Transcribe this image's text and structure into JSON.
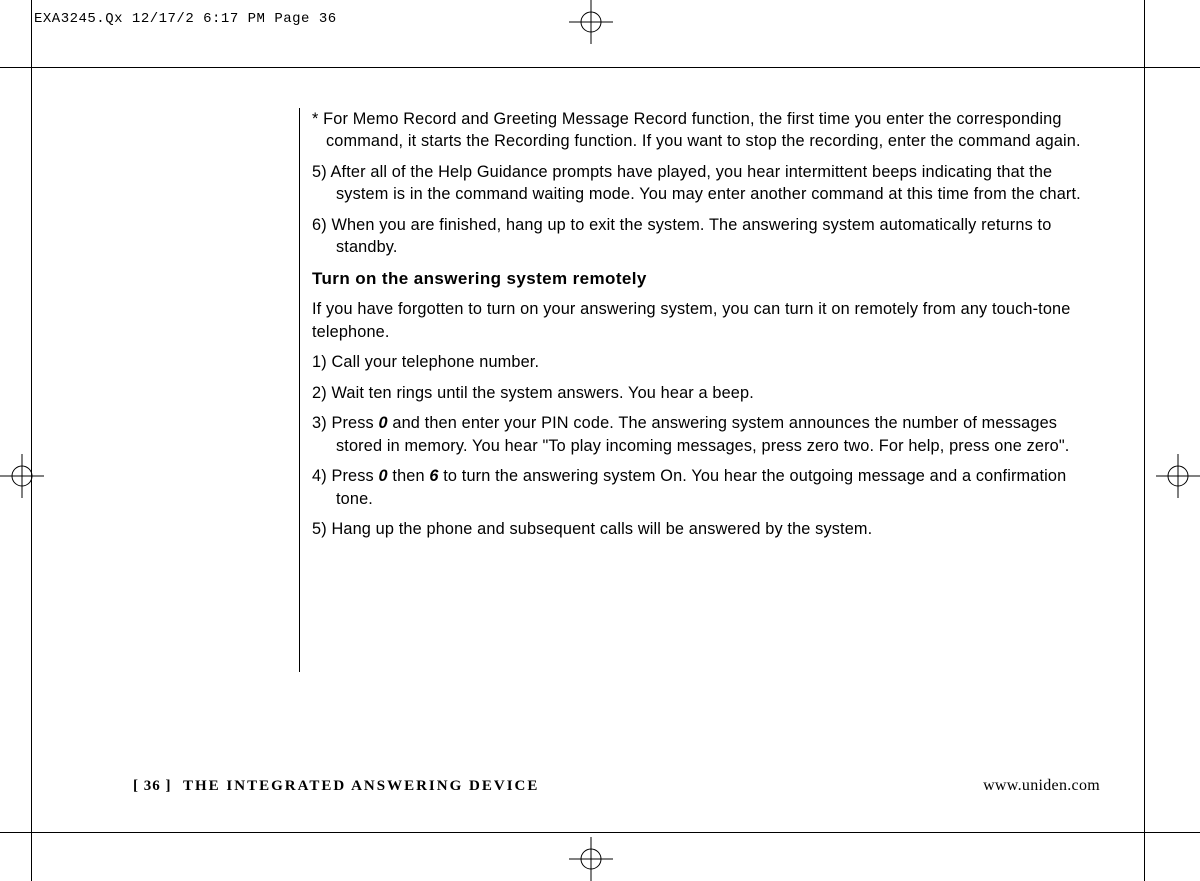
{
  "header": {
    "slug": "EXA3245.Qx  12/17/2 6:17 PM  Page 36"
  },
  "body": {
    "note": "* For Memo Record and Greeting Message Record function, the first time you enter the corresponding command, it starts the Recording function. If you want to stop the recording, enter the command again.",
    "step5": "5) After all of the Help Guidance prompts have played, you hear intermittent beeps indicating that the system is in the command waiting mode. You may enter another command at this time from the chart.",
    "step6": "6) When you are finished, hang up to exit the system. The answering system automatically returns to standby.",
    "heading": "Turn on the answering system remotely",
    "intro": "If you have forgotten to turn on your answering system, you can turn it on remotely from any touch-tone telephone.",
    "r1": "1) Call your telephone number.",
    "r2": "2) Wait ten rings until the system answers. You hear a beep.",
    "r3a": "3) Press ",
    "r3b": "0",
    "r3c": " and then enter your PIN code. The answering system announces the number of messages stored in memory. You hear \"To play incoming messages, press zero two. For help, press one zero\".",
    "r4a": "4) Press ",
    "r4b": "0",
    "r4c": " then ",
    "r4d": "6",
    "r4e": " to turn the answering system On. You hear the outgoing message and a confirmation tone.",
    "r5": "5) Hang up the phone and subsequent calls will be answered by the system."
  },
  "footer": {
    "page_bracket_open": "[ ",
    "page_number": "36",
    "page_bracket_close": " ]",
    "section_title": "THE INTEGRATED ANSWERING DEVICE",
    "url": "www.uniden.com"
  }
}
